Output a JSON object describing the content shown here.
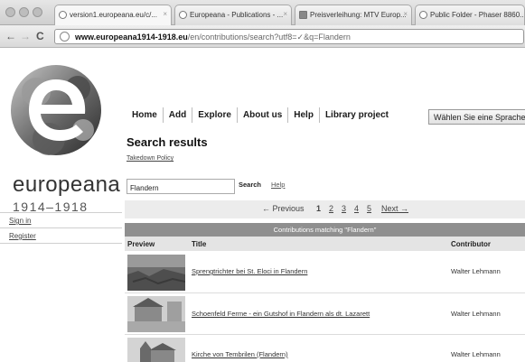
{
  "browser": {
    "tabs": [
      {
        "title": "version1.europeana.eu/c/..."
      },
      {
        "title": "Europeana - Publications - ..."
      },
      {
        "title": "Preisverleihung: MTV Europ..."
      },
      {
        "title": "Public Folder - Phaser 8860..."
      }
    ],
    "url_host": "www.europeana1914-1918.eu",
    "url_path": "/en/contributions/search?utf8=✓&q=Flandern"
  },
  "site": {
    "brand": "europeana",
    "years": "1914–1918",
    "sidebar": {
      "sign_in": "Sign in",
      "register": "Register"
    }
  },
  "nav": {
    "items": [
      "Home",
      "Add",
      "Explore",
      "About us",
      "Help",
      "Library project"
    ],
    "language_select": "Wählen Sie eine Sprache"
  },
  "main": {
    "heading": "Search results",
    "takedown": "Takedown Policy",
    "search": {
      "value": "Flandern",
      "button": "Search",
      "help": "Help"
    },
    "pager": {
      "previous": "← Previous",
      "pages": [
        "1",
        "2",
        "3",
        "4",
        "5"
      ],
      "next": "Next →"
    },
    "banner": "Contributions matching \"Flandern\"",
    "columns": {
      "preview": "Preview",
      "title": "Title",
      "contributor": "Contributor"
    },
    "rows": [
      {
        "title": "Sprengtrichter bei St. Eloci in Flandern",
        "contributor": "Walter Lehmann"
      },
      {
        "title": "Schoenfeld Ferme - ein Gutshof in Flandern als dt. Lazarett",
        "contributor": "Walter Lehmann"
      },
      {
        "title": "Kirche von Tembrilen (Flandern)",
        "contributor": "Walter Lehmann"
      }
    ]
  },
  "colors": {
    "banner": "#8f8f8f",
    "header_row": "#e4e4e4",
    "pager_bg": "#ececec"
  }
}
